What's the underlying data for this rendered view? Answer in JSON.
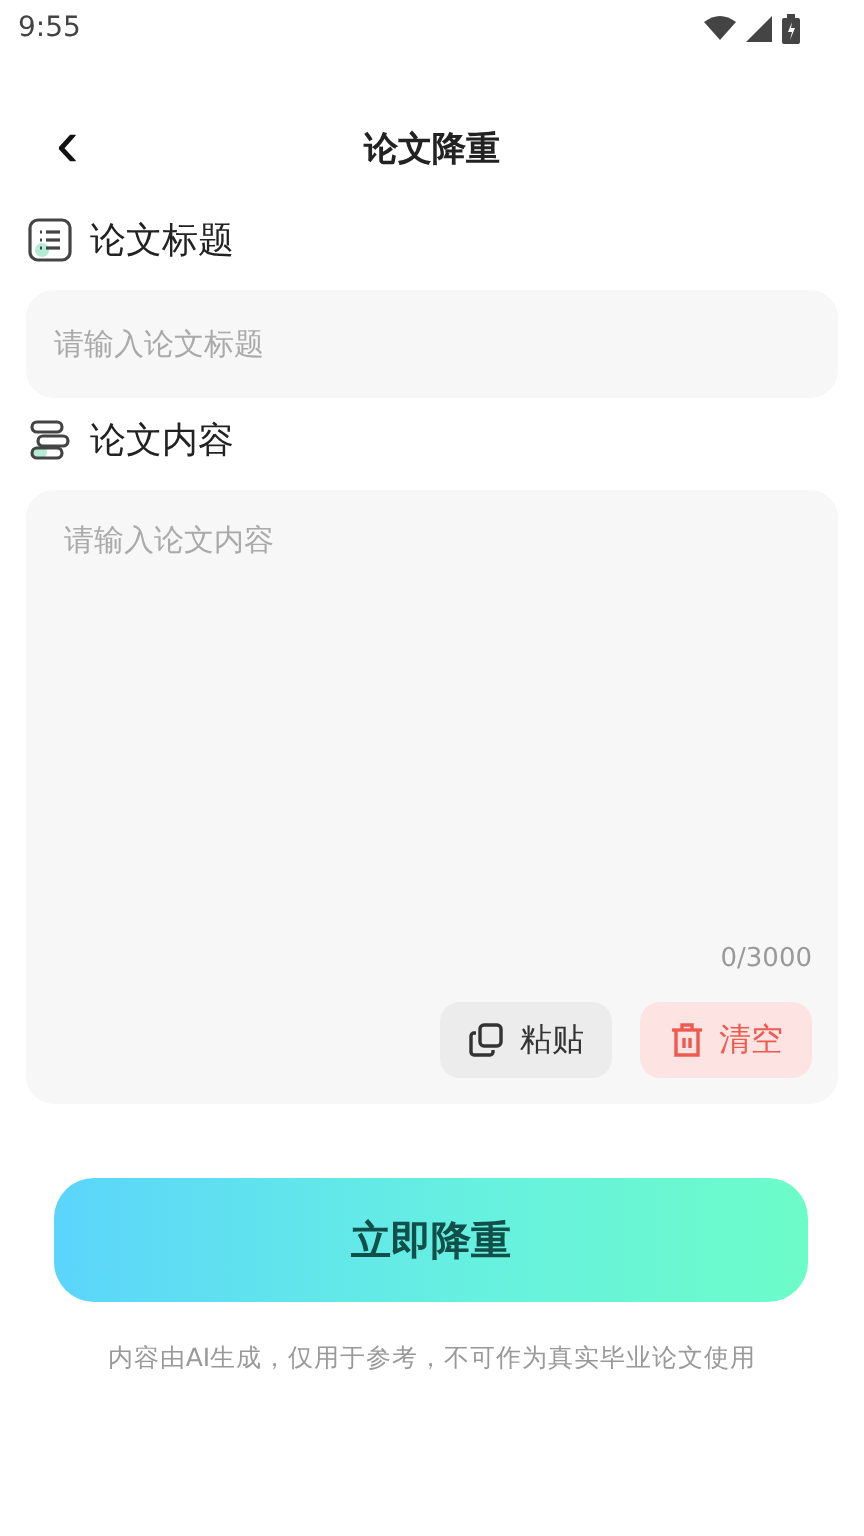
{
  "status_bar": {
    "time": "9:55"
  },
  "header": {
    "back_icon": "‹",
    "title": "论文降重"
  },
  "title_section": {
    "label": "论文标题",
    "placeholder": "请输入论文标题"
  },
  "content_section": {
    "label": "论文内容",
    "placeholder": "请输入论文内容",
    "counter": "0/3000"
  },
  "actions": [
    {
      "kind": "paste",
      "label": "粘贴"
    },
    {
      "kind": "clear",
      "label": "清空"
    }
  ],
  "submit_button": "立即降重",
  "disclaimer": "内容由AI生成，仅用于参考，不可作为真实毕业论文使用"
}
